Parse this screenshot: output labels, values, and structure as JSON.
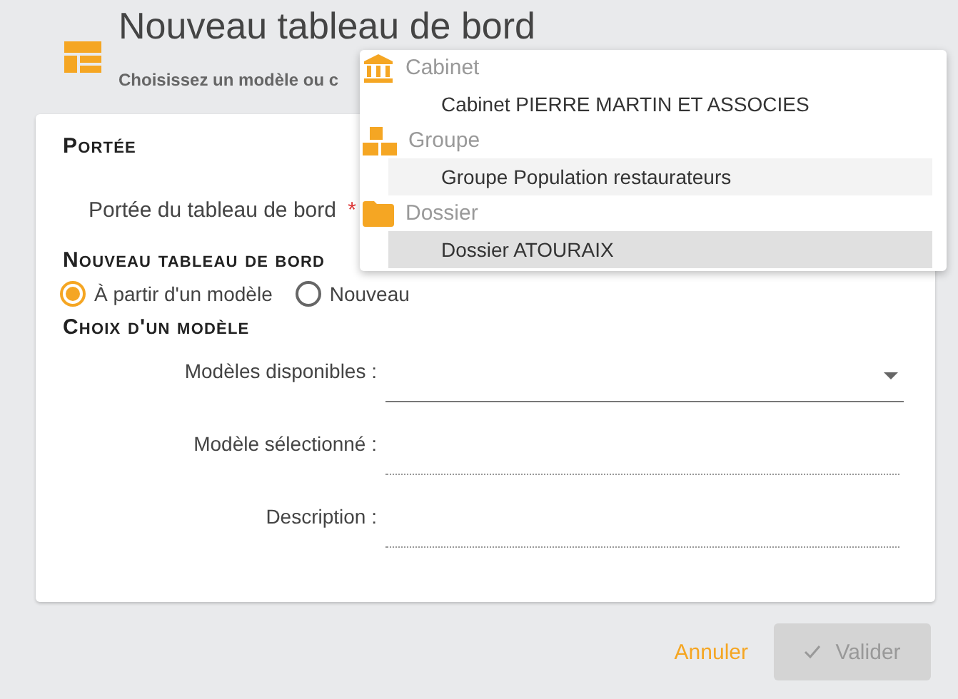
{
  "header": {
    "title": "Nouveau tableau de bord",
    "subtitle": "Choisissez un modèle ou c"
  },
  "card": {
    "sections": [
      {
        "kind": "scope",
        "title": "Portée",
        "label": "Portée du tableau de bord",
        "required_mark": "*"
      },
      {
        "kind": "radios",
        "title": "Nouveau tableau de bord",
        "options": [
          {
            "label": "À partir d'un modèle",
            "selected": true
          },
          {
            "label": "Nouveau",
            "selected": false
          }
        ]
      },
      {
        "kind": "fields",
        "title": "Choix d'un modèle",
        "fields": [
          {
            "label": "Modèles disponibles :",
            "kind": "select"
          },
          {
            "label": "Modèle sélectionné :",
            "kind": "readonly"
          },
          {
            "label": "Description :",
            "kind": "readonly"
          }
        ]
      }
    ]
  },
  "actions": {
    "cancel": "Annuler",
    "confirm": {
      "label": "Valider",
      "disabled": true
    }
  },
  "menu": {
    "groups": [
      {
        "kind": "cabinet",
        "label": "Cabinet",
        "options": [
          {
            "label": "Cabinet PIERRE MARTIN ET ASSOCIES",
            "selected": false,
            "hovered": false
          }
        ]
      },
      {
        "kind": "group",
        "label": "Groupe",
        "options": [
          {
            "label": "Groupe Population restaurateurs",
            "selected": false,
            "hovered": true
          }
        ]
      },
      {
        "kind": "folder",
        "label": "Dossier",
        "options": [
          {
            "label": "Dossier ATOURAIX",
            "selected": true,
            "hovered": false
          }
        ]
      }
    ]
  }
}
